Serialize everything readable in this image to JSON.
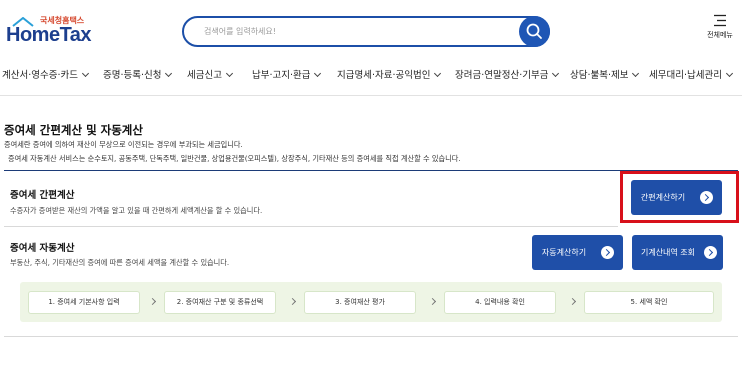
{
  "header": {
    "logo_sub": "국세청홈택스",
    "logo_main": "HomeTax",
    "search_placeholder": "검색어를 입력하세요!",
    "menu_all_label": "전체메뉴"
  },
  "nav": {
    "items": [
      {
        "label": "계산서·영수증·카드"
      },
      {
        "label": "증명·등록·신청"
      },
      {
        "label": "세금신고"
      },
      {
        "label": "납부·고지·환급"
      },
      {
        "label": "지급명세·자료·공익법인"
      },
      {
        "label": "장려금·연말정산·기부금"
      },
      {
        "label": "상담·불복·제보"
      },
      {
        "label": "세무대리·납세관리"
      }
    ]
  },
  "page": {
    "title": "증여세 간편계산 및 자동계산",
    "intro_1": "증여세란 증여에 의하여 재산이 무상으로 이전되는 경우에 부과되는 세금입니다.",
    "intro_2": "증여세 자동계산 서비스는 순수토지, 공동주택, 단독주택, 일반건물, 상업용건물(오피스텔), 상장주식, 기타재산 등의 증여세를 직접 계산할 수 있습니다."
  },
  "simple_calc": {
    "title": "증여세 간편계산",
    "desc": "수증자가 증여받은 재산의 가액을 알고 있을 때 간편하게 세액계산을 할 수 있습니다.",
    "button_label": "간편계산하기"
  },
  "auto_calc": {
    "title": "증여세 자동계산",
    "desc": "부동산, 주식, 기타재산의 증여에 따른 증여세 세액을 계산할 수 있습니다.",
    "auto_button_label": "자동계산하기",
    "history_button_label": "기계산내역 조회",
    "steps": [
      {
        "label": "1. 증여세 기본사항 입력"
      },
      {
        "label": "2. 증여재산 구분 및 종류선택"
      },
      {
        "label": "3. 증여재산 평가"
      },
      {
        "label": "4. 입력내용 확인"
      },
      {
        "label": "5. 세액 확인"
      }
    ]
  },
  "colors": {
    "brand_blue": "#1f4fa8",
    "highlight_red": "#d8101a",
    "steps_bg": "#eef5e5"
  }
}
